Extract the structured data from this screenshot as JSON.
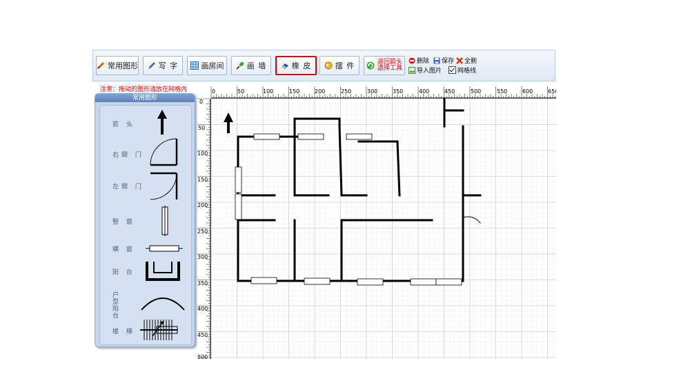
{
  "toolbar": {
    "buttons": [
      {
        "label": "常用图形",
        "icon": "pencil-icon"
      },
      {
        "label": "写 字",
        "icon": "pen-icon"
      },
      {
        "label": "画房间",
        "icon": "grid-room-icon"
      },
      {
        "label": "画 墙",
        "icon": "wall-brush-icon"
      },
      {
        "label": "橡 皮",
        "icon": "eraser-icon"
      },
      {
        "label": "摆 件",
        "icon": "furniture-icon"
      },
      {
        "label": "返回箭头\n选择工具",
        "icon": "refresh-arrow-icon"
      }
    ],
    "delete": "删除",
    "save": "保存",
    "clear_all": "全删",
    "import_image": "导入图片",
    "grid_line": "网格线"
  },
  "notice": "注意：拖动的图形请放在网格内",
  "panel": {
    "title": "常用图形",
    "shapes": [
      {
        "label": "箭 头"
      },
      {
        "label": "右開 门"
      },
      {
        "label": "左開 门"
      },
      {
        "label": "竪 窗"
      },
      {
        "label": "横 窗"
      },
      {
        "label": "阳 台"
      },
      {
        "label": "户型阳台"
      },
      {
        "label": "楼 梯"
      }
    ]
  },
  "ruler": {
    "x_labels": [
      "0",
      "50",
      "100",
      "150",
      "200",
      "250",
      "300",
      "350",
      "400",
      "450",
      "500",
      "550",
      "600",
      "650"
    ],
    "y_labels": [
      "0",
      "50",
      "100",
      "150",
      "200",
      "250",
      "300",
      "350",
      "400",
      "450",
      "500"
    ]
  },
  "colors": {
    "accent_red": "#d80000",
    "notice_red": "#e00000",
    "panel_blue": "#c5d5ea",
    "wall": "#000000"
  }
}
